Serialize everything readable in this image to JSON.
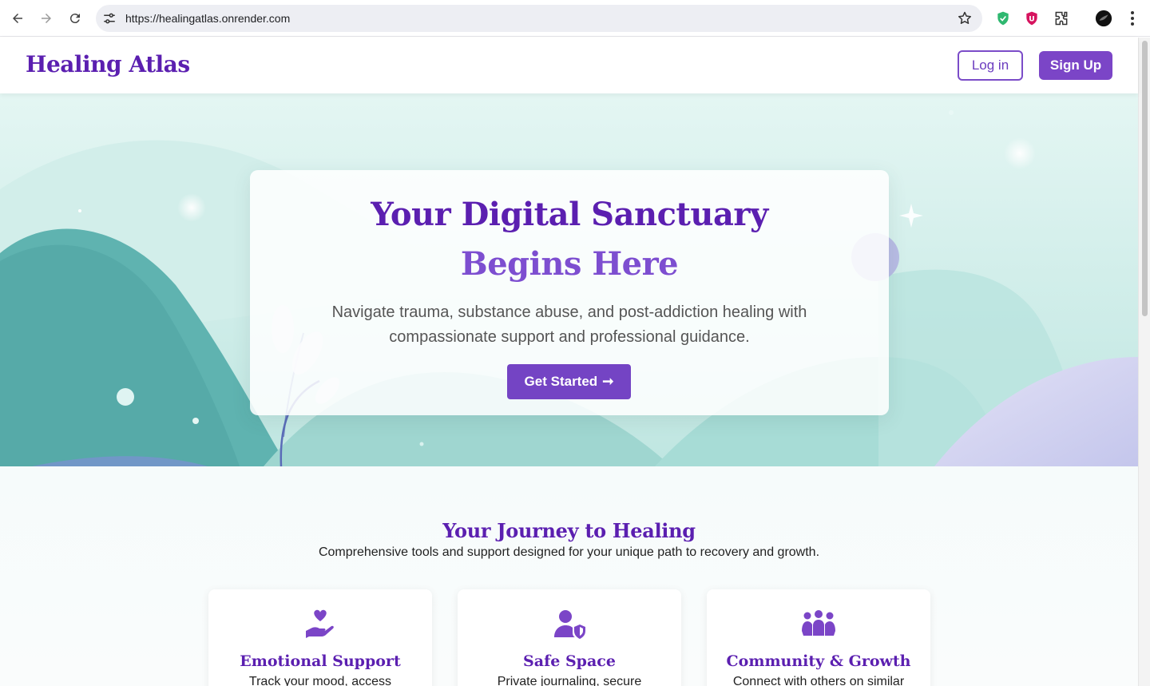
{
  "browser": {
    "url": "https://healingatlas.onrender.com"
  },
  "header": {
    "brand": "Healing Atlas",
    "login_label": "Log in",
    "signup_label": "Sign Up"
  },
  "hero": {
    "title_line1": "Your Digital Sanctuary",
    "title_line2": "Begins Here",
    "subtitle": "Navigate trauma, substance abuse, and post-addiction healing with compassionate support and professional guidance.",
    "cta_label": "Get Started",
    "cta_arrow": "➞"
  },
  "features": {
    "title": "Your Journey to Healing",
    "subtitle": "Comprehensive tools and support designed for your unique path to recovery and growth.",
    "cards": [
      {
        "title": "Emotional Support",
        "desc": "Track your mood, access",
        "icon": "hand-heart-icon"
      },
      {
        "title": "Safe Space",
        "desc": "Private journaling, secure",
        "icon": "user-shield-icon"
      },
      {
        "title": "Community & Growth",
        "desc": "Connect with others on similar",
        "icon": "people-group-icon"
      }
    ]
  },
  "colors": {
    "brand": "#5b1fb0",
    "accent": "#7b45c7",
    "hero_bg": "#b7e3de"
  }
}
